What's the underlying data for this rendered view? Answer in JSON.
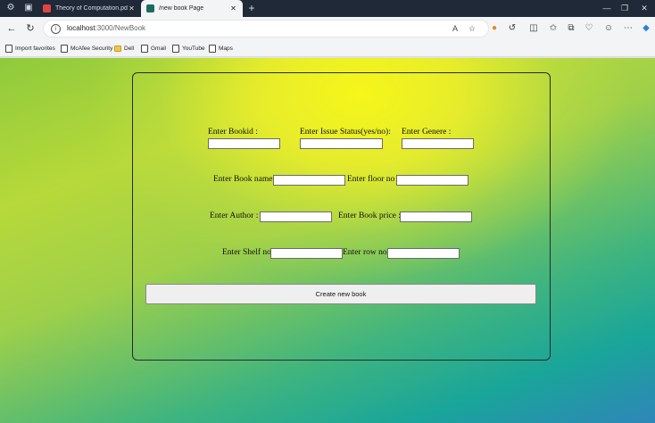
{
  "browser": {
    "tabs": [
      {
        "title": "Theory of Computation.pdf",
        "active": false,
        "favicon_color": "#e04444"
      },
      {
        "title": "/new book Page",
        "active": true,
        "favicon_color": "#1b6b5c"
      }
    ],
    "new_tab_symbol": "+",
    "address": {
      "host": "localhost",
      "path": ":3000/NewBook"
    },
    "bookmarks": [
      "Import favorites",
      "McAfee Security",
      "Dell",
      "Gmail",
      "YouTube",
      "Maps"
    ]
  },
  "form": {
    "bookid_label": "Enter Bookid :",
    "issue_status_label": "Enter Issue Status(yes/no):",
    "genre_label": "Enter Genere :",
    "book_name_label": "Enter Book name :",
    "floor_label": "Enter floor no :",
    "author_label": "Enter Author :",
    "price_label": "Enter Book price :",
    "shelf_label": "Enter Shelf no :",
    "row_label": "Enter row no :",
    "bookid_value": "",
    "issue_status_value": "",
    "genre_value": "",
    "book_name_value": "",
    "floor_value": "",
    "author_value": "",
    "price_value": "",
    "shelf_value": "",
    "row_value": "",
    "submit_label": "Create new book"
  }
}
